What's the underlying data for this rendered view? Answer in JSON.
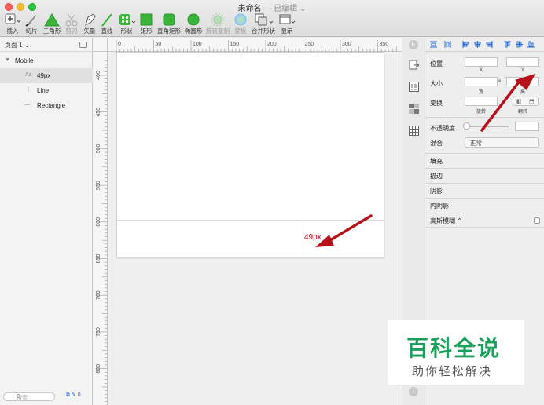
{
  "window": {
    "title": "未命名",
    "subtitle": "— 已编辑 ⌄"
  },
  "toolbar": {
    "items": [
      {
        "name": "insert",
        "label": "插入"
      },
      {
        "name": "slice",
        "label": "切片"
      },
      {
        "name": "triangle",
        "label": "三角形"
      },
      {
        "name": "scissors",
        "label": "剪刀"
      },
      {
        "name": "vector",
        "label": "矢量"
      },
      {
        "name": "line",
        "label": "直线"
      },
      {
        "name": "shape",
        "label": "形状"
      },
      {
        "name": "rectangle",
        "label": "矩形"
      },
      {
        "name": "rounded-rect",
        "label": "直角矩形"
      },
      {
        "name": "oval",
        "label": "椭圆形"
      },
      {
        "name": "rotate-copy",
        "label": "旋转复制"
      },
      {
        "name": "mask",
        "label": "蒙板"
      },
      {
        "name": "combine",
        "label": "合并形状"
      },
      {
        "name": "display",
        "label": "显示"
      }
    ],
    "colors": {
      "green": "#3ab53a",
      "red": "#d0021b"
    }
  },
  "layers": {
    "pages_label": "页面 1 ⌄",
    "artboard": "Mobile",
    "items": [
      {
        "icon": "Aa",
        "label": "49px"
      },
      {
        "icon": "|",
        "label": "Line"
      },
      {
        "icon": "—",
        "label": "Rectangle"
      }
    ],
    "search_placeholder": "搜索",
    "layer_count": "0"
  },
  "ruler": {
    "h_labels": [
      "0",
      "50",
      "100",
      "150",
      "200",
      "250",
      "300",
      "350"
    ],
    "v_labels": [
      "400",
      "450",
      "500",
      "550",
      "600",
      "650",
      "700",
      "750",
      "800"
    ]
  },
  "canvas": {
    "size_label": "49px"
  },
  "inspector": {
    "position_label": "位置",
    "x_caption": "X",
    "y_caption": "Y",
    "size_label": "大小",
    "width_caption": "宽",
    "height_caption": "高",
    "transform_label": "变换",
    "rotate_caption": "旋转",
    "flip_caption": "翻转",
    "opacity_label": "不透明度",
    "blend_label": "混合",
    "blend_value": "正常",
    "sections": [
      "填充",
      "描边",
      "阴影",
      "内阴影",
      "高斯模糊 ⌃"
    ]
  },
  "watermark": {
    "title": "百科全说",
    "subtitle": "助你轻松解决"
  }
}
